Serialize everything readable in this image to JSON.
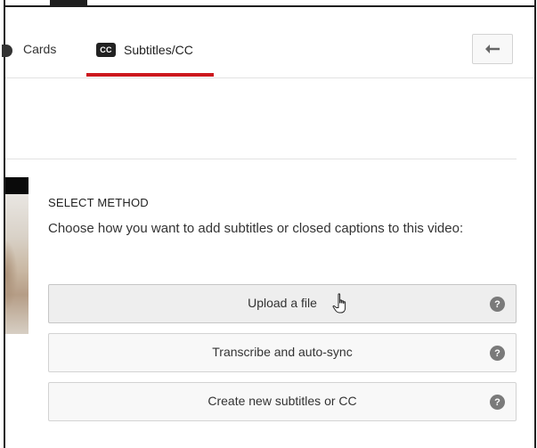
{
  "tabs": {
    "cards_label": "Cards",
    "subtitles_label": "Subtitles/CC",
    "cc_badge": "CC",
    "active_underline_color": "#cc181e"
  },
  "toolbar": {
    "back_icon": "arrow-left-icon"
  },
  "method_panel": {
    "title": "SELECT METHOD",
    "description": "Choose how you want to add subtitles or closed captions to this video:",
    "options": [
      {
        "label": "Upload a file",
        "help": "?"
      },
      {
        "label": "Transcribe and auto-sync",
        "help": "?"
      },
      {
        "label": "Create new subtitles or CC",
        "help": "?"
      }
    ]
  },
  "icons": {
    "help": "help-circle-icon",
    "cursor": "hand-pointer-cursor"
  }
}
